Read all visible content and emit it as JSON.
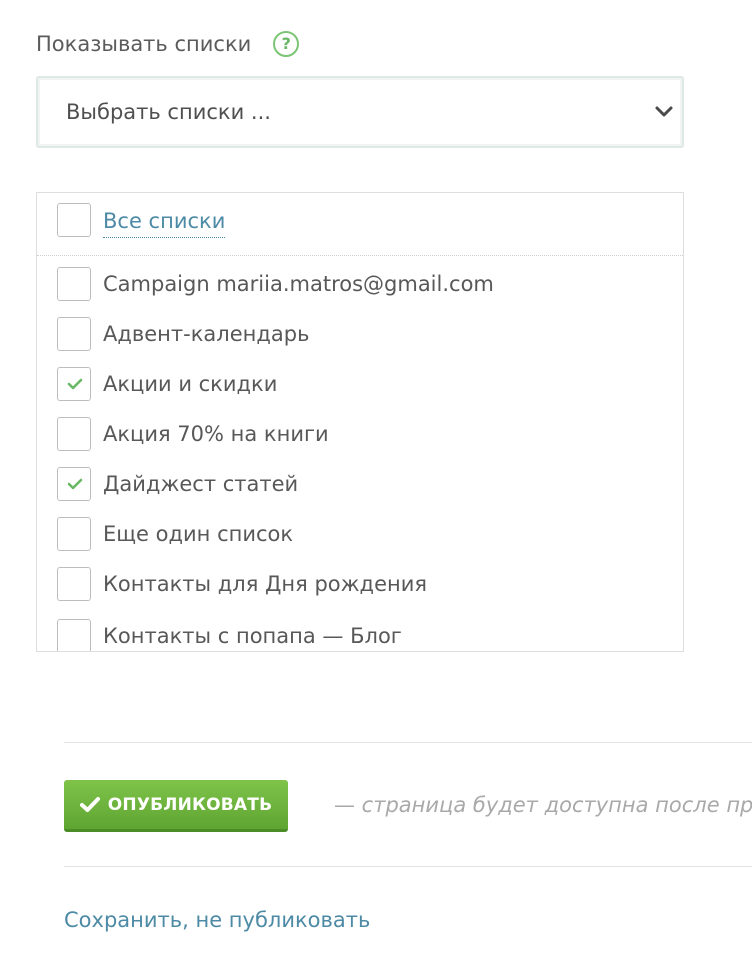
{
  "field": {
    "label": "Показывать списки",
    "help_icon": "?"
  },
  "select": {
    "value": "Выбрать списки ..."
  },
  "list": {
    "all_label": "Все списки",
    "all_checked": false,
    "items": [
      {
        "label": "Campaign mariia.matros@gmail.com",
        "checked": false
      },
      {
        "label": "Адвент-календарь",
        "checked": false
      },
      {
        "label": "Акции и скидки",
        "checked": true
      },
      {
        "label": "Акция 70% на книги",
        "checked": false
      },
      {
        "label": "Дайджест статей",
        "checked": true
      },
      {
        "label": "Еще один список",
        "checked": false
      },
      {
        "label": "Контакты для Дня рождения",
        "checked": false
      },
      {
        "label": "Контакты с попапа — Блог",
        "checked": false
      }
    ]
  },
  "actions": {
    "publish_label": "ОПУБЛИКОВАТЬ",
    "publish_note": "— страница будет доступна после пр",
    "save_label": "Сохранить, не публиковать"
  },
  "colors": {
    "accent_green": "#6ab866",
    "link_blue": "#4d8aa6"
  }
}
